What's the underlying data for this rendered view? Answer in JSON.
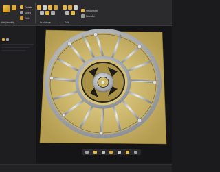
{
  "ribbon": {
    "tool_label": "Add/modify",
    "small_buttons": [
      "Delete",
      "Show",
      "Edit"
    ],
    "group_sculpt": "Sculpture",
    "group_edit": "Edit",
    "right_buttons": [
      "Smoothen",
      "Rebuild"
    ]
  },
  "colors": {
    "accent": "#e8b84a",
    "sculpt_base": "#d8c47a",
    "relief": "#bcc0c6",
    "background": "#151517"
  }
}
